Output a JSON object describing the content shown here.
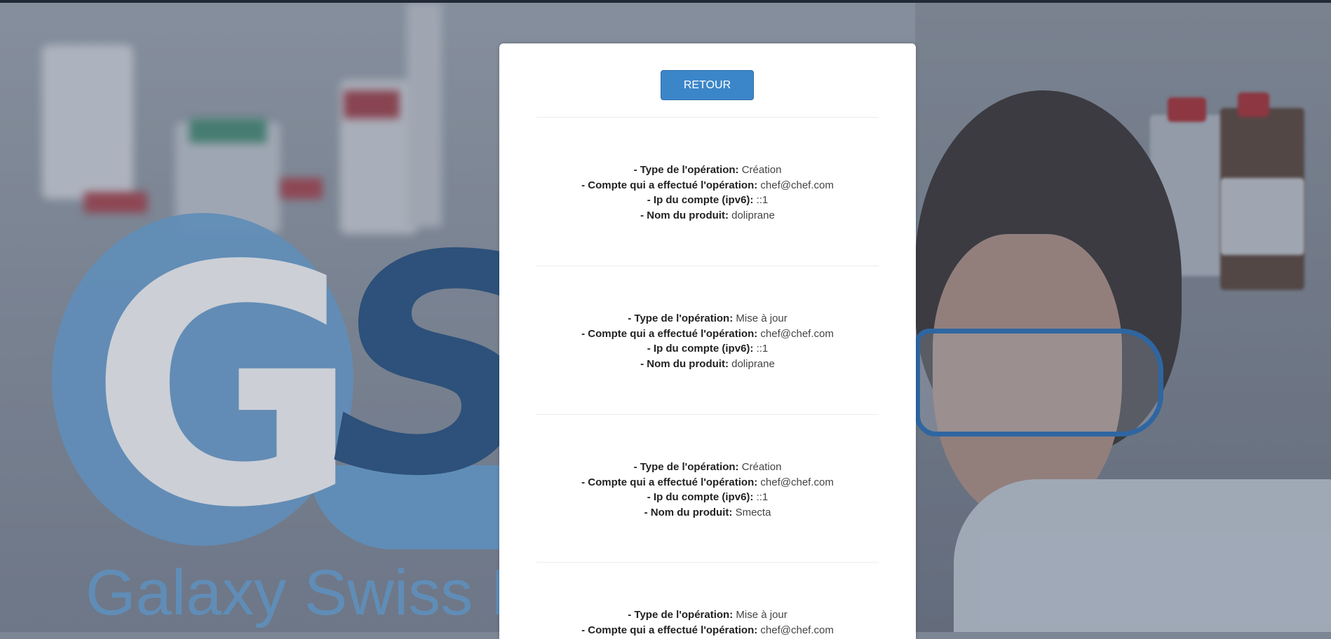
{
  "background": {
    "logo_letters": "GS",
    "logo_text": "Galaxy Swiss Bo"
  },
  "panel": {
    "back_button": "RETOUR",
    "labels": {
      "type": "- Type de l'opération:",
      "account": "- Compte qui a effectué l'opération:",
      "ip": "- Ip du compte (ipv6):",
      "product": "- Nom du produit:"
    },
    "entries": [
      {
        "type": "Création",
        "account": "chef@chef.com",
        "ip": "::1",
        "product": "doliprane"
      },
      {
        "type": "Mise à jour",
        "account": "chef@chef.com",
        "ip": "::1",
        "product": "doliprane"
      },
      {
        "type": "Création",
        "account": "chef@chef.com",
        "ip": "::1",
        "product": "Smecta"
      },
      {
        "type": "Mise à jour",
        "account": "chef@chef.com",
        "ip": "",
        "product": ""
      }
    ]
  },
  "colors": {
    "button": "#3b86c9",
    "logo_light_blue": "#6b9fce",
    "logo_dark_blue": "#2d5683"
  }
}
